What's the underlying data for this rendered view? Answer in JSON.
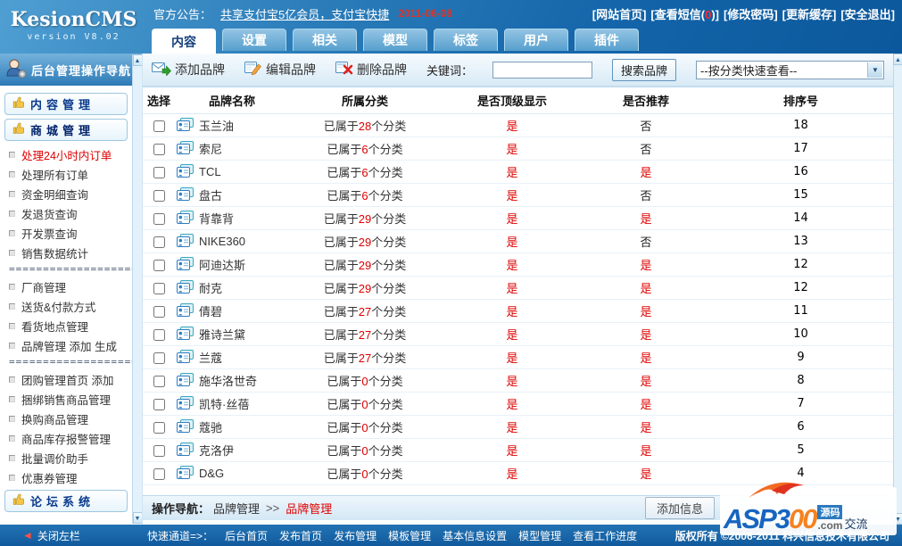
{
  "header": {
    "logo": {
      "title": "KesionCMS",
      "version": "version V8.02"
    },
    "announcement": {
      "label": "官方公告：",
      "link": "共享支付宝5亿会员，支付宝快捷",
      "date": "2011-06-08"
    },
    "nav_links": [
      "[网站首页]",
      "[修改密码]",
      "[更新缓存]",
      "[安全退出]"
    ],
    "sms_link": {
      "prefix": "[查看短信(",
      "count": "0",
      "suffix": ")]"
    },
    "tabs": [
      {
        "label": "内容",
        "active": true
      },
      {
        "label": "设置"
      },
      {
        "label": "相关"
      },
      {
        "label": "模型"
      },
      {
        "label": "标签"
      },
      {
        "label": "用户"
      },
      {
        "label": "插件"
      }
    ]
  },
  "sidebar": {
    "title": "后台管理操作导航",
    "entries": [
      {
        "type": "panel",
        "label": "内容管理"
      },
      {
        "type": "panel",
        "label": "商城管理",
        "active": true
      },
      {
        "type": "item",
        "label": "处理24小时内订单",
        "red": true
      },
      {
        "type": "item",
        "label": "处理所有订单"
      },
      {
        "type": "item",
        "label": "资金明细查询"
      },
      {
        "type": "item",
        "label": "发退货查询"
      },
      {
        "type": "item",
        "label": "开发票查询"
      },
      {
        "type": "item",
        "label": "销售数据统计"
      },
      {
        "type": "divider",
        "label": "===================="
      },
      {
        "type": "item",
        "label": "厂商管理"
      },
      {
        "type": "item",
        "label": "送货&付款方式"
      },
      {
        "type": "item",
        "label": "看货地点管理"
      },
      {
        "type": "item",
        "label": "品牌管理 添加 生成"
      },
      {
        "type": "divider",
        "label": "===================="
      },
      {
        "type": "item",
        "label": "团购管理首页 添加"
      },
      {
        "type": "item",
        "label": "捆绑销售商品管理"
      },
      {
        "type": "item",
        "label": "换购商品管理"
      },
      {
        "type": "item",
        "label": "商品库存报警管理"
      },
      {
        "type": "item",
        "label": "批量调价助手"
      },
      {
        "type": "item",
        "label": "优惠券管理"
      },
      {
        "type": "panel",
        "label": "论坛系统"
      }
    ]
  },
  "toolbar": {
    "add_label": "添加品牌",
    "edit_label": "编辑品牌",
    "delete_label": "删除品牌",
    "keyword_label": "关键词：",
    "keyword_value": "",
    "search_label": "搜索品牌",
    "filter_selected": "--按分类快速查看--"
  },
  "table": {
    "headers": [
      "选择",
      "品牌名称",
      "所属分类",
      "是否顶级显示",
      "是否推荐",
      "排序号"
    ],
    "category_prefix": "已属于",
    "category_suffix": "个分类",
    "rows": [
      {
        "name": "玉兰油",
        "category_count": "28",
        "top": "是",
        "recommend": "否",
        "sort": "18"
      },
      {
        "name": "索尼",
        "category_count": "6",
        "top": "是",
        "recommend": "否",
        "sort": "17"
      },
      {
        "name": "TCL",
        "category_count": "6",
        "top": "是",
        "recommend": "是",
        "sort": "16"
      },
      {
        "name": "盘古",
        "category_count": "6",
        "top": "是",
        "recommend": "否",
        "sort": "15"
      },
      {
        "name": "背靠背",
        "category_count": "29",
        "top": "是",
        "recommend": "是",
        "sort": "14"
      },
      {
        "name": "NIKE360",
        "category_count": "29",
        "top": "是",
        "recommend": "否",
        "sort": "13"
      },
      {
        "name": "阿迪达斯",
        "category_count": "29",
        "top": "是",
        "recommend": "是",
        "sort": "12"
      },
      {
        "name": "耐克",
        "category_count": "29",
        "top": "是",
        "recommend": "是",
        "sort": "12"
      },
      {
        "name": "倩碧",
        "category_count": "27",
        "top": "是",
        "recommend": "是",
        "sort": "11"
      },
      {
        "name": "雅诗兰黛",
        "category_count": "27",
        "top": "是",
        "recommend": "是",
        "sort": "10"
      },
      {
        "name": "兰蔻",
        "category_count": "27",
        "top": "是",
        "recommend": "是",
        "sort": "9"
      },
      {
        "name": "施华洛世奇",
        "category_count": "0",
        "top": "是",
        "recommend": "是",
        "sort": "8"
      },
      {
        "name": "凯特·丝蓓",
        "category_count": "0",
        "top": "是",
        "recommend": "是",
        "sort": "7"
      },
      {
        "name": "蔻驰",
        "category_count": "0",
        "top": "是",
        "recommend": "是",
        "sort": "6"
      },
      {
        "name": "克洛伊",
        "category_count": "0",
        "top": "是",
        "recommend": "是",
        "sort": "5"
      },
      {
        "name": "D&G",
        "category_count": "0",
        "top": "是",
        "recommend": "是",
        "sort": "4"
      }
    ]
  },
  "action_bar": {
    "nav_label": "操作导航：",
    "crumb1": "品牌管理",
    "separator": ">>",
    "crumb2": "品牌管理",
    "add_info_label": "添加信息"
  },
  "watermark": {
    "brand_prefix": "ASP3",
    "brand_suffix": "00",
    "box": "源码",
    "domain": ".com",
    "tail": "交流"
  },
  "footer": {
    "close_label": "关闭左栏",
    "quick_label": "快速通道=>：",
    "links": [
      "后台首页",
      "发布首页",
      "发布管理",
      "模板管理",
      "基本信息设置",
      "模型管理",
      "查看工作进度"
    ],
    "copyright": "版权所有 ©2006-2011 科兴信息技术有限公司"
  },
  "colors": {
    "accent": "#1a6db1",
    "status_red": "#e00000",
    "tab_active_text": "#14407b"
  }
}
